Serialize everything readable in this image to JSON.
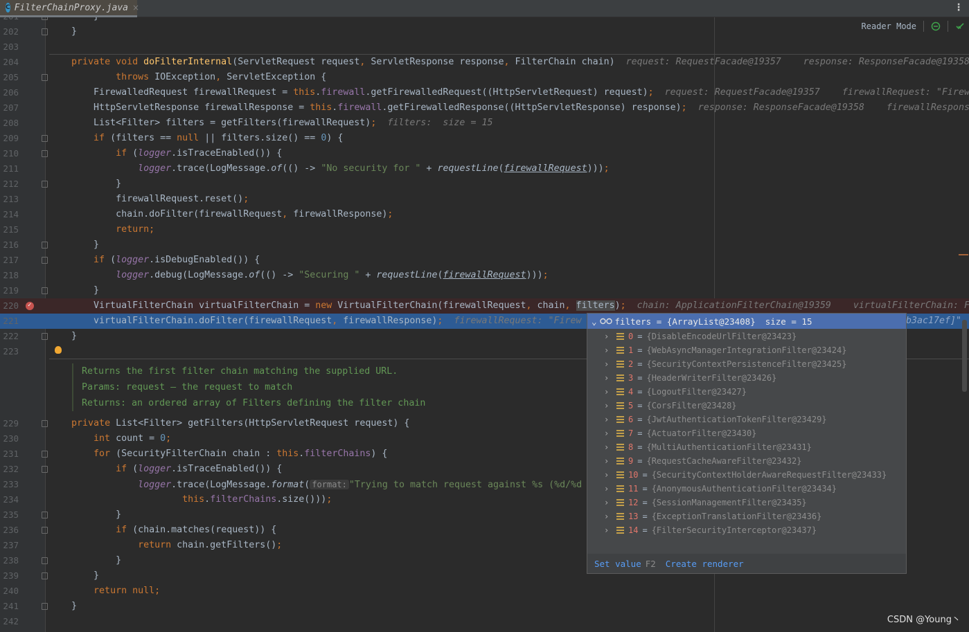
{
  "tab": {
    "icon": "java-class-icon",
    "icon_letter": "C",
    "title": "FilterChainProxy.java",
    "close": "×"
  },
  "reader": {
    "label": "Reader Mode",
    "icons": [
      "no-problems-icon",
      "check-icon"
    ]
  },
  "colors": {
    "keyword": "#cc7832",
    "method": "#ffc66d",
    "field": "#9876aa",
    "string": "#6a8759",
    "highlight": "#2d5b94",
    "breakpoint": "#c75450",
    "accent": "#4b6eaf"
  },
  "code_top": [
    {
      "n": "201",
      "fold": true,
      "t": [
        [
          "p",
          "        }"
        ]
      ]
    },
    {
      "n": "202",
      "fold": true,
      "t": [
        [
          "p",
          "    }"
        ]
      ]
    },
    {
      "n": "203",
      "t": []
    },
    {
      "n": "204",
      "t": [
        [
          "p",
          "    "
        ],
        [
          "kw",
          "private void "
        ],
        [
          "fn",
          "doFilterInternal"
        ],
        [
          "p",
          "(ServletRequest request, ServletResponse response, FilterChain chain)  "
        ],
        [
          "hint",
          "request: RequestFacade@19357    response: ResponseFacade@19358"
        ]
      ]
    },
    {
      "n": "205",
      "fold": true,
      "t": [
        [
          "p",
          "            "
        ],
        [
          "kw",
          "throws "
        ],
        [
          "p",
          "IOException, ServletException {"
        ]
      ]
    },
    {
      "n": "206",
      "t": [
        [
          "p",
          "        FirewalledRequest firewallRequest = "
        ],
        [
          "kw",
          "this"
        ],
        [
          "p",
          "."
        ],
        [
          "fld",
          "firewall"
        ],
        [
          "p",
          ".getFirewalledRequest((HttpServletRequest) request);  "
        ],
        [
          "hint",
          "request: RequestFacade@19357    firewallRequest: \"Firew"
        ]
      ]
    },
    {
      "n": "207",
      "t": [
        [
          "p",
          "        HttpServletResponse firewallResponse = "
        ],
        [
          "kw",
          "this"
        ],
        [
          "p",
          "."
        ],
        [
          "fld",
          "firewall"
        ],
        [
          "p",
          ".getFirewalledResponse((HttpServletResponse) response);  "
        ],
        [
          "hint",
          "response: ResponseFacade@19358    firewallRespons"
        ]
      ]
    },
    {
      "n": "208",
      "t": [
        [
          "p",
          "        List<Filter> filters = getFilters(firewallRequest);  "
        ],
        [
          "hint",
          "filters:  size = 15"
        ]
      ]
    },
    {
      "n": "209",
      "fold": true,
      "t": [
        [
          "p",
          "        "
        ],
        [
          "kw",
          "if "
        ],
        [
          "p",
          "(filters == "
        ],
        [
          "kw",
          "null "
        ],
        [
          "p",
          "|| filters.size() == "
        ],
        [
          "num",
          "0"
        ],
        [
          "p",
          ") {"
        ]
      ]
    },
    {
      "n": "210",
      "fold": true,
      "t": [
        [
          "p",
          "            "
        ],
        [
          "kw",
          "if "
        ],
        [
          "p",
          "("
        ],
        [
          "fit",
          "logger"
        ],
        [
          "p",
          ".isTraceEnabled()) {"
        ]
      ]
    },
    {
      "n": "211",
      "t": [
        [
          "p",
          "                "
        ],
        [
          "fit",
          "logger"
        ],
        [
          "p",
          ".trace(LogMessage."
        ],
        [
          "sit",
          "of"
        ],
        [
          "p",
          "(() -> "
        ],
        [
          "str",
          "\"No security for \""
        ],
        [
          "p",
          " + "
        ],
        [
          "sit",
          "requestLine"
        ],
        [
          "p",
          "("
        ],
        [
          "ul",
          "firewallRequest"
        ],
        [
          "p",
          ")));"
        ]
      ]
    },
    {
      "n": "212",
      "fold": true,
      "t": [
        [
          "p",
          "            }"
        ]
      ]
    },
    {
      "n": "213",
      "t": [
        [
          "p",
          "            firewallRequest.reset();"
        ]
      ]
    },
    {
      "n": "214",
      "t": [
        [
          "p",
          "            chain.doFilter(firewallRequest, firewallResponse);"
        ]
      ]
    },
    {
      "n": "215",
      "t": [
        [
          "p",
          "            "
        ],
        [
          "kw",
          "return;"
        ]
      ]
    },
    {
      "n": "216",
      "fold": true,
      "t": [
        [
          "p",
          "        }"
        ]
      ]
    },
    {
      "n": "217",
      "fold": true,
      "t": [
        [
          "p",
          "        "
        ],
        [
          "kw",
          "if "
        ],
        [
          "p",
          "("
        ],
        [
          "fit",
          "logger"
        ],
        [
          "p",
          ".isDebugEnabled()) {"
        ]
      ]
    },
    {
      "n": "218",
      "t": [
        [
          "p",
          "            "
        ],
        [
          "fit",
          "logger"
        ],
        [
          "p",
          ".debug(LogMessage."
        ],
        [
          "sit",
          "of"
        ],
        [
          "p",
          "(() -> "
        ],
        [
          "str",
          "\"Securing \""
        ],
        [
          "p",
          " + "
        ],
        [
          "sit",
          "requestLine"
        ],
        [
          "p",
          "("
        ],
        [
          "ul",
          "firewallRequest"
        ],
        [
          "p",
          ")));"
        ]
      ]
    },
    {
      "n": "219",
      "fold": true,
      "t": [
        [
          "p",
          "        }"
        ]
      ]
    },
    {
      "n": "220",
      "bg": "red",
      "bp": true,
      "t": [
        [
          "p",
          "        VirtualFilterChain virtualFilterChain = "
        ],
        [
          "kw",
          "new "
        ],
        [
          "p",
          "VirtualFilterChain(firewallRequest, chain, "
        ],
        [
          "hl",
          "filters"
        ],
        [
          "p",
          ");  "
        ],
        [
          "hint",
          "chain: ApplicationFilterChain@19359    virtualFilterChain: F"
        ]
      ]
    },
    {
      "n": "221",
      "bg": "blue",
      "t": [
        [
          "p",
          "        virtualFilterChain.doFilter(firewallRequest, firewallResponse);  "
        ],
        [
          "hint",
          "firewallRequest: \"Firew"
        ]
      ]
    },
    {
      "n": "222",
      "fold": true,
      "t": [
        [
          "p",
          "    }"
        ]
      ]
    },
    {
      "n": "223",
      "bulb": true,
      "t": []
    }
  ],
  "line221_tail": "b3ac17ef]\"",
  "doc": {
    "summary": "Returns the first filter chain matching the supplied URL.",
    "params": "Params:  request – the request to match",
    "returns": "Returns: an ordered array of Filters defining the filter chain"
  },
  "code_bottom": [
    {
      "n": "229",
      "fold": true,
      "t": [
        [
          "p",
          "    "
        ],
        [
          "kw",
          "private "
        ],
        [
          "p",
          "List<Filter> getFilters(HttpServletRequest request) {"
        ]
      ]
    },
    {
      "n": "230",
      "t": [
        [
          "p",
          "        "
        ],
        [
          "kw",
          "int "
        ],
        [
          "p",
          "count = "
        ],
        [
          "num",
          "0"
        ],
        [
          "p",
          ";"
        ]
      ]
    },
    {
      "n": "231",
      "fold": true,
      "t": [
        [
          "p",
          "        "
        ],
        [
          "kw",
          "for "
        ],
        [
          "p",
          "(SecurityFilterChain chain : "
        ],
        [
          "kw",
          "this"
        ],
        [
          "p",
          "."
        ],
        [
          "fld",
          "filterChains"
        ],
        [
          "p",
          ") {"
        ]
      ]
    },
    {
      "n": "232",
      "fold": true,
      "t": [
        [
          "p",
          "            "
        ],
        [
          "kw",
          "if "
        ],
        [
          "p",
          "("
        ],
        [
          "fit",
          "logger"
        ],
        [
          "p",
          ".isTraceEnabled()) {"
        ]
      ]
    },
    {
      "n": "233",
      "t": [
        [
          "p",
          "                "
        ],
        [
          "fit",
          "logger"
        ],
        [
          "p",
          ".trace(LogMessage."
        ],
        [
          "sit",
          "format"
        ],
        [
          "p",
          "("
        ],
        [
          "ph",
          "format:"
        ],
        [
          "str",
          "\"Trying to match request against %s (%d/%d"
        ]
      ]
    },
    {
      "n": "234",
      "t": [
        [
          "p",
          "                        "
        ],
        [
          "kw",
          "this"
        ],
        [
          "p",
          "."
        ],
        [
          "fld",
          "filterChains"
        ],
        [
          "p",
          ".size()));"
        ]
      ]
    },
    {
      "n": "235",
      "fold": true,
      "t": [
        [
          "p",
          "            }"
        ]
      ]
    },
    {
      "n": "236",
      "fold": true,
      "t": [
        [
          "p",
          "            "
        ],
        [
          "kw",
          "if "
        ],
        [
          "p",
          "(chain.matches(request)) {"
        ]
      ]
    },
    {
      "n": "237",
      "t": [
        [
          "p",
          "                "
        ],
        [
          "kw",
          "return "
        ],
        [
          "p",
          "chain.getFilters();"
        ]
      ]
    },
    {
      "n": "238",
      "fold": true,
      "t": [
        [
          "p",
          "            }"
        ]
      ]
    },
    {
      "n": "239",
      "fold": true,
      "t": [
        [
          "p",
          "        }"
        ]
      ]
    },
    {
      "n": "240",
      "t": [
        [
          "p",
          "        "
        ],
        [
          "kw",
          "return null;"
        ]
      ]
    },
    {
      "n": "241",
      "fold": true,
      "t": [
        [
          "p",
          "    }"
        ]
      ]
    },
    {
      "n": "242",
      "t": []
    }
  ],
  "popup": {
    "header": {
      "chevron": "⌄",
      "icon": "watch-glasses-icon",
      "text": "filters = {ArrayList@23408}",
      "size": "size = 15"
    },
    "items": [
      {
        "i": "0",
        "v": "{DisableEncodeUrlFilter@23423}"
      },
      {
        "i": "1",
        "v": "{WebAsyncManagerIntegrationFilter@23424}"
      },
      {
        "i": "2",
        "v": "{SecurityContextPersistenceFilter@23425}"
      },
      {
        "i": "3",
        "v": "{HeaderWriterFilter@23426}"
      },
      {
        "i": "4",
        "v": "{LogoutFilter@23427}"
      },
      {
        "i": "5",
        "v": "{CorsFilter@23428}"
      },
      {
        "i": "6",
        "v": "{JwtAuthenticationTokenFilter@23429}"
      },
      {
        "i": "7",
        "v": "{ActuatorFilter@23430}"
      },
      {
        "i": "8",
        "v": "{MultiAuthenticationFilter@23431}"
      },
      {
        "i": "9",
        "v": "{RequestCacheAwareFilter@23432}"
      },
      {
        "i": "10",
        "v": "{SecurityContextHolderAwareRequestFilter@23433}"
      },
      {
        "i": "11",
        "v": "{AnonymousAuthenticationFilter@23434}"
      },
      {
        "i": "12",
        "v": "{SessionManagementFilter@23435}"
      },
      {
        "i": "13",
        "v": "{ExceptionTranslationFilter@23436}"
      },
      {
        "i": "14",
        "v": "{FilterSecurityInterceptor@23437}"
      }
    ],
    "set_value": "Set value",
    "set_value_key": "F2",
    "create_renderer": "Create renderer"
  },
  "watermark": "CSDN @Young丶"
}
